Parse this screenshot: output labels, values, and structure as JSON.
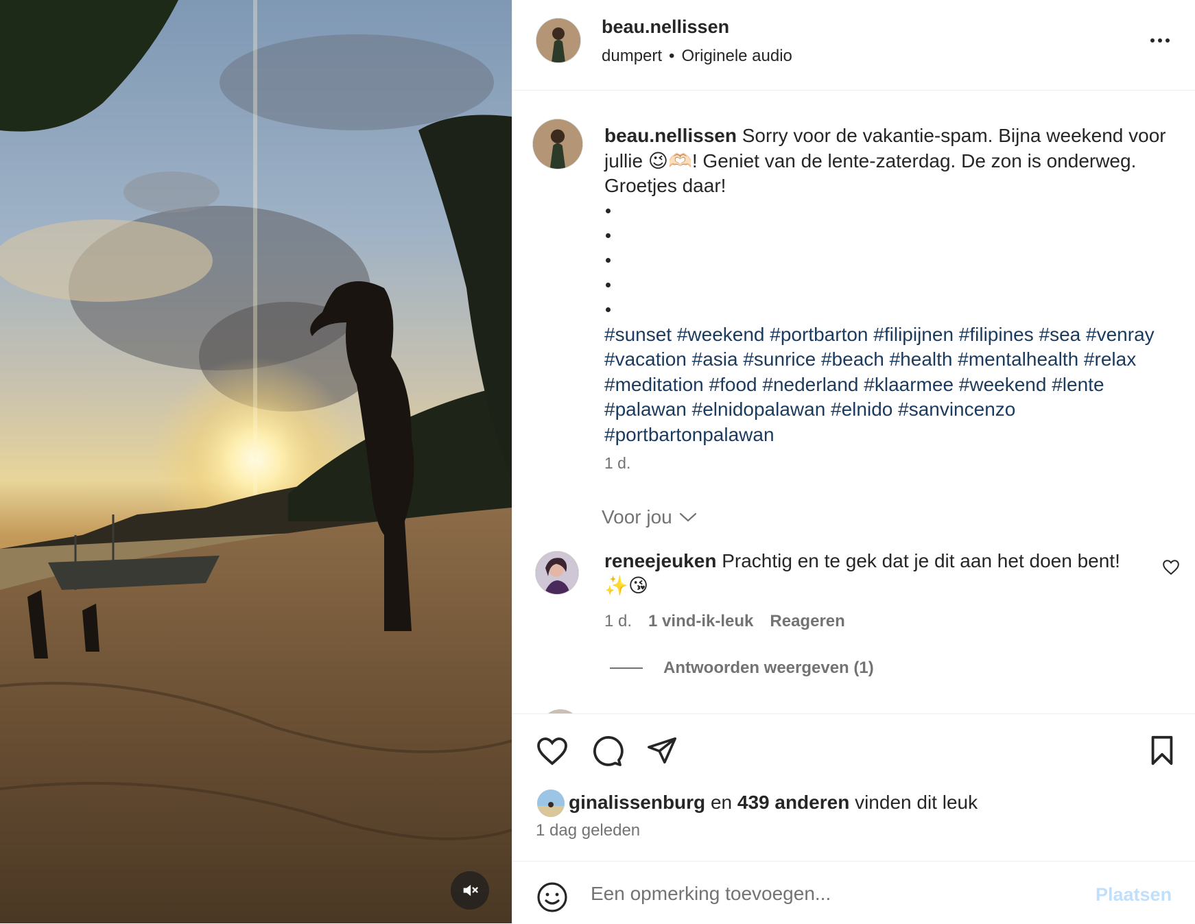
{
  "post": {
    "username": "beau.nellissen",
    "audio_artist": "dumpert",
    "separator": "•",
    "audio_title": "Originele audio"
  },
  "caption": {
    "username": "beau.nellissen",
    "text": "Sorry voor de vakantie-spam. Bijna weekend voor jullie 😉🫶🏻! Geniet van de lente-zaterdag. De zon is onderweg. Groetjes daar!",
    "hashtags": "#sunset #weekend #portbarton #filipijnen #filipines #sea #venray #vacation #asia #sunrice #beach #health #mentalhealth #relax #meditation #food #nederland #klaarmee #weekend #lente #palawan #elnidopalawan #elnido #sanvincenzo #portbartonpalawan",
    "time": "1 d."
  },
  "filter": {
    "label": "Voor jou"
  },
  "comment": {
    "username": "reneejeuken",
    "text": "Prachtig en te gek dat je dit aan het doen bent! ✨😘",
    "time": "1 d.",
    "likes": "1 vind-ik-leuk",
    "reply_label": "Reageren",
    "view_replies": "Antwoorden weergeven (1)"
  },
  "likes": {
    "first_user": "ginalissenburg",
    "connector": "en",
    "others": "439 anderen",
    "suffix": "vinden dit leuk"
  },
  "post_time": "1 dag geleden",
  "comment_box": {
    "placeholder": "Een opmerking toevoegen...",
    "post_label": "Plaatsen",
    "post_label_color": "#c0dffd"
  },
  "colors": {
    "hashtag": "#1a3a5e",
    "secondary_text": "#737373",
    "primary_text": "#262626"
  },
  "icons": {
    "more": "more-horizontal-icon",
    "like": "heart-icon",
    "comment": "speech-bubble-icon",
    "share": "paper-plane-icon",
    "save": "bookmark-icon",
    "emoji": "smiley-icon",
    "mute": "speaker-muted-icon",
    "chevron": "chevron-down-icon"
  }
}
